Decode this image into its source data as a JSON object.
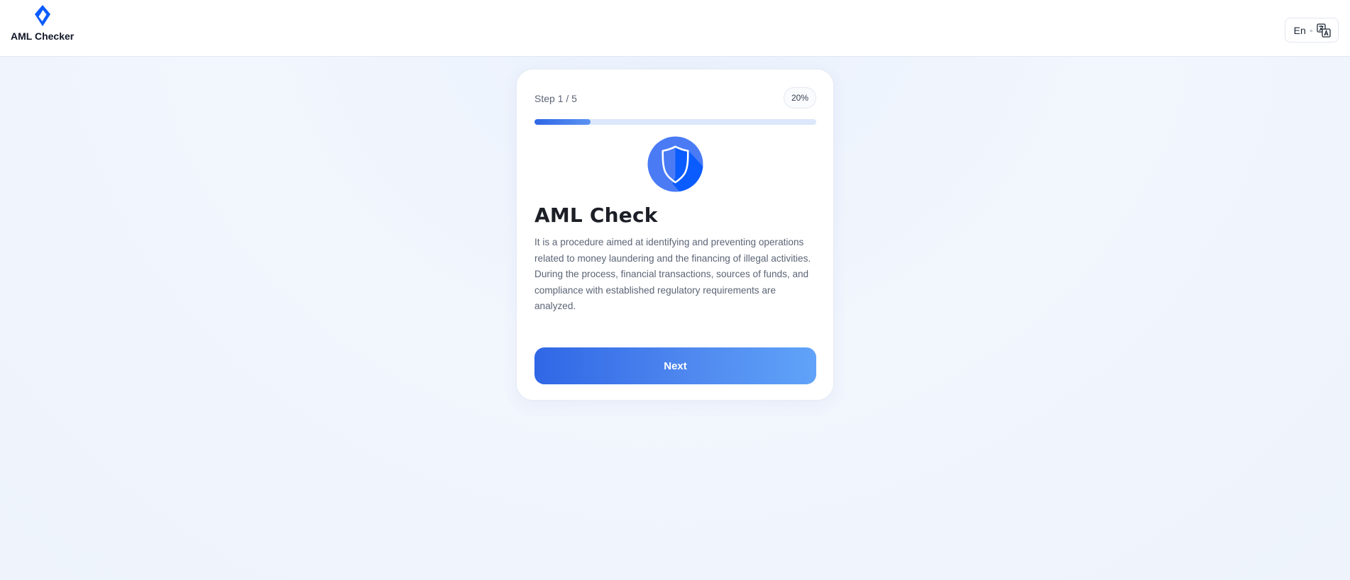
{
  "header": {
    "brand_name": "AML Checker",
    "logo_icon": "diamond-logo-icon",
    "language": {
      "code": "En",
      "caret": "▫",
      "icon": "translate-icon"
    }
  },
  "card": {
    "step_label": "Step 1 / 5",
    "percent_label": "20%",
    "progress": 0.2,
    "hero_icon": "shield-icon",
    "title": "AML Check",
    "description": "It is a procedure aimed at identifying and preventing operations related to money laundering and the financing of illegal activities. During the process, financial transactions, sources of funds, and compliance with established regulatory requirements are analyzed.",
    "next_label": "Next"
  },
  "colors": {
    "accent": "#2f67e6",
    "accent_light": "#60a3f9",
    "icon_blue": "#0a5cff",
    "progress_track": "#dce7fb"
  }
}
